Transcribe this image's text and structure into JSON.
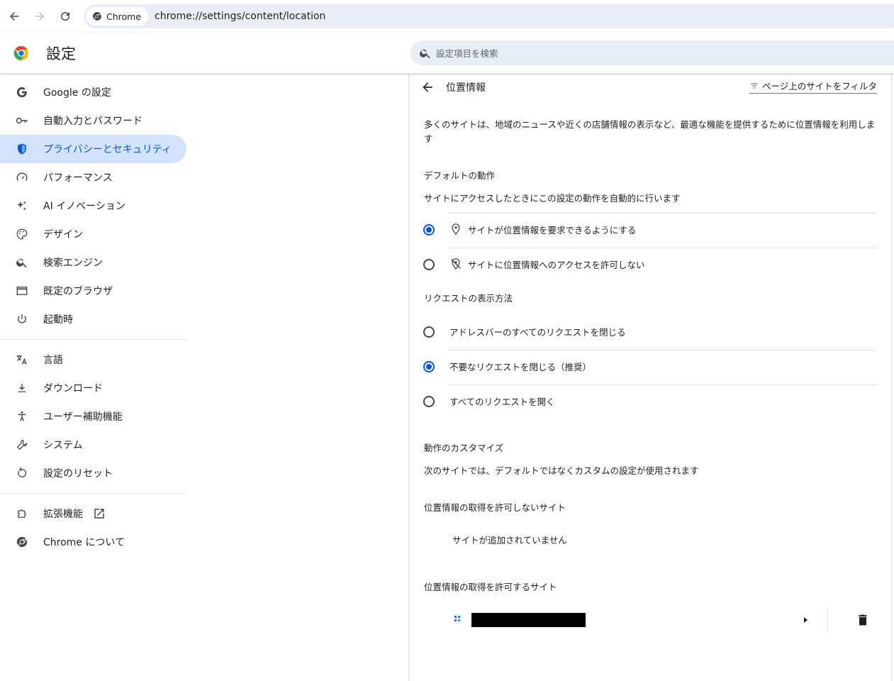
{
  "browser": {
    "chip_label": "Chrome",
    "url": "chrome://settings/content/location"
  },
  "header": {
    "title": "設定",
    "search_placeholder": "設定項目を検索"
  },
  "sidebar": {
    "items": [
      {
        "label": "Google の設定",
        "icon": "google-g-icon"
      },
      {
        "label": "自動入力とパスワード",
        "icon": "key-icon"
      },
      {
        "label": "プライバシーとセキュリティ",
        "icon": "shield-icon",
        "active": true
      },
      {
        "label": "パフォーマンス",
        "icon": "speedometer-icon"
      },
      {
        "label": "AI イノベーション",
        "icon": "sparkle-icon"
      },
      {
        "label": "デザイン",
        "icon": "palette-icon"
      },
      {
        "label": "検索エンジン",
        "icon": "search-icon"
      },
      {
        "label": "既定のブラウザ",
        "icon": "browser-window-icon"
      },
      {
        "label": "起動時",
        "icon": "power-icon"
      },
      {
        "label": "言語",
        "icon": "translate-icon"
      },
      {
        "label": "ダウンロード",
        "icon": "download-icon"
      },
      {
        "label": "ユーザー補助機能",
        "icon": "accessibility-icon"
      },
      {
        "label": "システム",
        "icon": "wrench-icon"
      },
      {
        "label": "設定のリセット",
        "icon": "reset-icon"
      },
      {
        "label": "拡張機能",
        "icon": "puzzle-icon"
      },
      {
        "label": "Chrome について",
        "icon": "chrome-logo-icon"
      }
    ]
  },
  "main": {
    "title": "位置情報",
    "filter_label": "ページ上のサイトをフィルタ",
    "description": "多くのサイトは、地域のニュースや近くの店舗情報の表示など、最適な機能を提供するために位置情報を利用します",
    "default_behavior": {
      "title": "デフォルトの動作",
      "subtitle": "サイトにアクセスしたときにこの設定の動作を自動的に行います",
      "options": [
        {
          "label": "サイトが位置情報を要求できるようにする",
          "checked": true,
          "icon": "location-pin-icon"
        },
        {
          "label": "サイトに位置情報へのアクセスを許可しない",
          "checked": false,
          "icon": "location-off-icon"
        }
      ]
    },
    "request_display": {
      "title": "リクエストの表示方法",
      "options": [
        {
          "label": "アドレスバーのすべてのリクエストを閉じる",
          "checked": false
        },
        {
          "label": "不要なリクエストを閉じる（推奨）",
          "checked": true
        },
        {
          "label": "すべてのリクエストを開く",
          "checked": false
        }
      ]
    },
    "customize": {
      "title": "動作のカスタマイズ",
      "subtitle": "次のサイトでは、デフォルトではなくカスタムの設定が使用されます"
    },
    "blocked": {
      "title": "位置情報の取得を許可しないサイト",
      "empty_text": "サイトが追加されていません"
    },
    "allowed": {
      "title": "位置情報の取得を許可するサイト"
    }
  },
  "colors": {
    "accent": "#0b57d0",
    "active_nav_bg": "#d3e3fd",
    "omnibox_bg": "#e9eef6"
  }
}
